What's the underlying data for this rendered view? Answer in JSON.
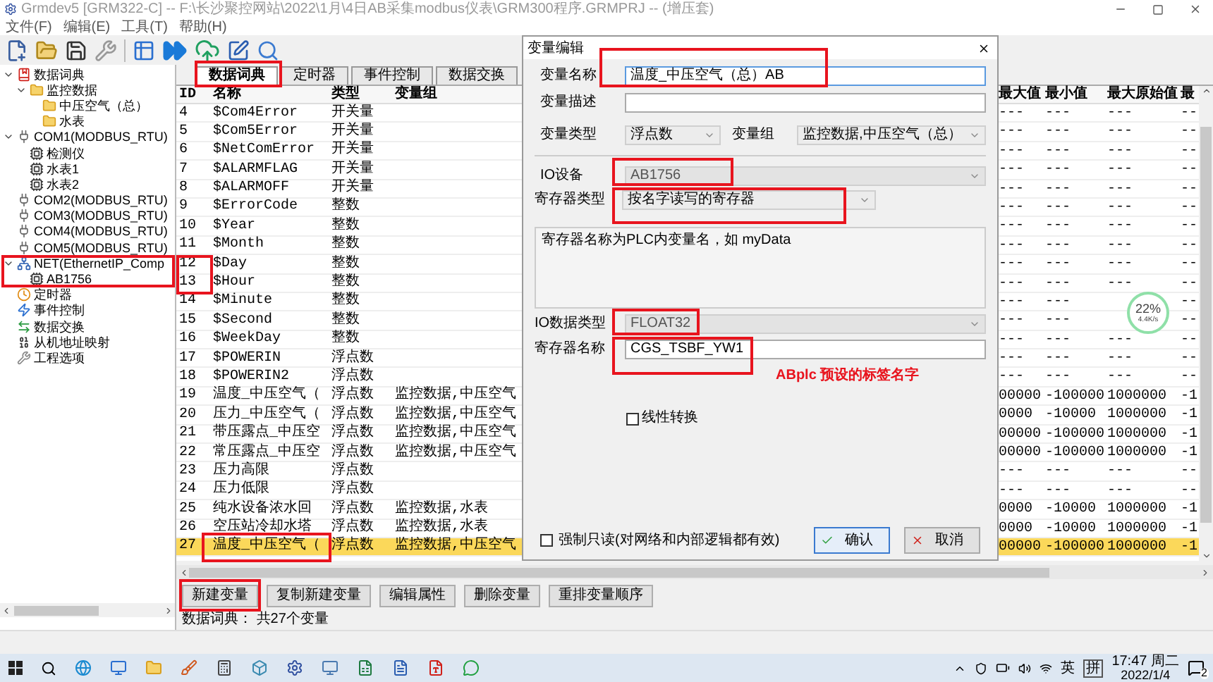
{
  "window": {
    "title": "Grmdev5 [GRM322-C] -- F:\\长沙聚控网站\\2022\\1月\\4日AB采集modbus仪表\\GRM300程序.GRMPRJ -- (增压套)"
  },
  "menu": [
    "文件(F)",
    "编辑(E)",
    "工具(T)",
    "帮助(H)"
  ],
  "tree": [
    {
      "label": "数据词典",
      "kind": "book",
      "expanded": true,
      "children": [
        {
          "label": "监控数据",
          "kind": "folder",
          "expanded": true,
          "children": [
            {
              "label": "中压空气（总）",
              "kind": "folder"
            },
            {
              "label": "水表",
              "kind": "folder"
            }
          ]
        }
      ]
    },
    {
      "label": "COM1(MODBUS_RTU)",
      "kind": "port",
      "expanded": true,
      "children": [
        {
          "label": "检测仪",
          "kind": "device"
        },
        {
          "label": "水表1",
          "kind": "device"
        },
        {
          "label": "水表2",
          "kind": "device"
        }
      ]
    },
    {
      "label": "COM2(MODBUS_RTU)",
      "kind": "port"
    },
    {
      "label": "COM3(MODBUS_RTU)",
      "kind": "port"
    },
    {
      "label": "COM4(MODBUS_RTU)",
      "kind": "port"
    },
    {
      "label": "COM5(MODBUS_RTU)",
      "kind": "port"
    },
    {
      "label": "NET(EthernetIP_Comp",
      "kind": "net",
      "expanded": true,
      "children": [
        {
          "label": "AB1756",
          "kind": "device"
        }
      ]
    },
    {
      "label": "定时器",
      "kind": "timer"
    },
    {
      "label": "事件控制",
      "kind": "event"
    },
    {
      "label": "数据交换",
      "kind": "exchange"
    },
    {
      "label": "从机地址映射",
      "kind": "map"
    },
    {
      "label": "工程选项",
      "kind": "options"
    }
  ],
  "tabs": [
    {
      "label": "数据词典",
      "selected": true
    },
    {
      "label": "定时器",
      "selected": false
    },
    {
      "label": "事件控制",
      "selected": false
    },
    {
      "label": "数据交换",
      "selected": false
    }
  ],
  "table": {
    "columns": [
      "ID",
      "名称",
      "类型",
      "变量组",
      "最大值",
      "最小值",
      "最大原始值",
      "最"
    ],
    "rows": [
      {
        "id": "4",
        "name": "$Com4Error",
        "type": "开关量",
        "group": "",
        "max": "---",
        "min": "---",
        "raw_max": "---",
        "column_8": "--",
        "selected": false
      },
      {
        "id": "5",
        "name": "$Com5Error",
        "type": "开关量",
        "group": "",
        "max": "---",
        "min": "---",
        "raw_max": "---",
        "column_8": "--",
        "selected": false
      },
      {
        "id": "6",
        "name": "$NetComError",
        "type": "开关量",
        "group": "",
        "max": "---",
        "min": "---",
        "raw_max": "---",
        "column_8": "--",
        "selected": false
      },
      {
        "id": "7",
        "name": "$ALARMFLAG",
        "type": "开关量",
        "group": "",
        "max": "---",
        "min": "---",
        "raw_max": "---",
        "column_8": "--",
        "selected": false
      },
      {
        "id": "8",
        "name": "$ALARMOFF",
        "type": "开关量",
        "group": "",
        "max": "---",
        "min": "---",
        "raw_max": "---",
        "column_8": "--",
        "selected": false
      },
      {
        "id": "9",
        "name": "$ErrorCode",
        "type": "整数",
        "group": "",
        "max": "---",
        "min": "---",
        "raw_max": "---",
        "column_8": "--",
        "selected": false
      },
      {
        "id": "10",
        "name": "$Year",
        "type": "整数",
        "group": "",
        "max": "---",
        "min": "---",
        "raw_max": "---",
        "column_8": "--",
        "selected": false
      },
      {
        "id": "11",
        "name": "$Month",
        "type": "整数",
        "group": "",
        "max": "---",
        "min": "---",
        "raw_max": "---",
        "column_8": "--",
        "selected": false
      },
      {
        "id": "12",
        "name": "$Day",
        "type": "整数",
        "group": "",
        "max": "---",
        "min": "---",
        "raw_max": "---",
        "column_8": "--",
        "selected": false
      },
      {
        "id": "13",
        "name": "$Hour",
        "type": "整数",
        "group": "",
        "max": "---",
        "min": "---",
        "raw_max": "---",
        "column_8": "--",
        "selected": false
      },
      {
        "id": "14",
        "name": "$Minute",
        "type": "整数",
        "group": "",
        "max": "---",
        "min": "---",
        "column_8": "--",
        "selected": false
      },
      {
        "id": "15",
        "name": "$Second",
        "type": "整数",
        "group": "",
        "max": "---",
        "min": "---",
        "column_8": "--",
        "selected": false
      },
      {
        "id": "16",
        "name": "$WeekDay",
        "type": "整数",
        "group": "",
        "max": "---",
        "min": "---",
        "raw_max": "---",
        "column_8": "--",
        "selected": false
      },
      {
        "id": "17",
        "name": "$POWERIN",
        "type": "浮点数",
        "group": "",
        "max": "---",
        "min": "---",
        "raw_max": "---",
        "column_8": "--",
        "selected": false
      },
      {
        "id": "18",
        "name": "$POWERIN2",
        "type": "浮点数",
        "group": "",
        "max": "---",
        "min": "---",
        "raw_max": "---",
        "column_8": "--",
        "selected": false
      },
      {
        "id": "19",
        "name": "温度_中压空气（",
        "type": "浮点数",
        "group": "监控数据,中压空气",
        "max": "00000",
        "min": "-100000",
        "raw_max": "1000000",
        "column_8": "-1",
        "selected": false
      },
      {
        "id": "20",
        "name": "压力_中压空气（",
        "type": "浮点数",
        "group": "监控数据,中压空气",
        "max": "0000",
        "min": "-10000",
        "raw_max": "1000000",
        "column_8": "-1",
        "selected": false
      },
      {
        "id": "21",
        "name": "带压露点_中压空",
        "type": "浮点数",
        "group": "监控数据,中压空气",
        "max": "00000",
        "min": "-100000",
        "raw_max": "1000000",
        "column_8": "-1",
        "selected": false
      },
      {
        "id": "22",
        "name": "常压露点_中压空",
        "type": "浮点数",
        "group": "监控数据,中压空气",
        "max": "00000",
        "min": "-100000",
        "raw_max": "1000000",
        "column_8": "-1",
        "selected": false
      },
      {
        "id": "23",
        "name": "压力高限",
        "type": "浮点数",
        "group": "",
        "max": "---",
        "min": "---",
        "raw_max": "---",
        "column_8": "--",
        "selected": false
      },
      {
        "id": "24",
        "name": "压力低限",
        "type": "浮点数",
        "group": "",
        "max": "---",
        "min": "---",
        "raw_max": "---",
        "column_8": "--",
        "selected": false
      },
      {
        "id": "25",
        "name": "纯水设备浓水回",
        "type": "浮点数",
        "group": "监控数据,水表",
        "max": "0000",
        "min": "-10000",
        "raw_max": "1000000",
        "column_8": "-1",
        "selected": false
      },
      {
        "id": "26",
        "name": "空压站冷却水塔",
        "type": "浮点数",
        "group": "监控数据,水表",
        "max": "0000",
        "min": "-10000",
        "raw_max": "1000000",
        "column_8": "-1",
        "selected": false
      },
      {
        "id": "27",
        "name": "温度_中压空气（",
        "type": "浮点数",
        "group": "监控数据,中压空气",
        "max": "00000",
        "min": "-100000",
        "raw_max": "1000000",
        "column_8": "-1",
        "selected": true
      }
    ]
  },
  "buttons": [
    "新建变量",
    "复制新建变量",
    "编辑属性",
    "删除变量",
    "重排变量顺序"
  ],
  "status_bar": "数据词典： 共27个变量",
  "dialog": {
    "title": "变量编辑",
    "name": {
      "label": "变量名称",
      "value": "温度_中压空气（总）AB"
    },
    "description": {
      "label": "变量描述"
    },
    "var_type": {
      "label": "变量类型",
      "value": "浮点数"
    },
    "var_group": {
      "label": "变量组",
      "value": "监控数据,中压空气（总）"
    },
    "io_device": {
      "label": "IO设备",
      "value": "AB1756",
      "disabled": true
    },
    "register_type": {
      "label": "寄存器类型",
      "value": "按名字读写的寄存器",
      "disabled": false
    },
    "hint": "寄存器名称为PLC内变量名，如 myData",
    "io_data_type": {
      "label": "IO数据类型",
      "value": "FLOAT32",
      "disabled": true
    },
    "register_name": {
      "label": "寄存器名称",
      "value": "CGS_TSBF_YW1"
    },
    "annotation_note": "ABplc 预设的标签名字",
    "linear": {
      "label": "线性转换",
      "checked": false
    },
    "readonly": {
      "label": "强制只读(对网络和内部逻辑都有效)",
      "checked": false
    },
    "ok": "确认",
    "cancel": "取消"
  },
  "speed_widget": {
    "percent": "22%",
    "speed": "4.4K/s"
  },
  "taskbar": {
    "ime": "英",
    "ime_mode": "拼",
    "time": "17:47 周二",
    "date": "2022/1/4",
    "notifications": "2"
  }
}
